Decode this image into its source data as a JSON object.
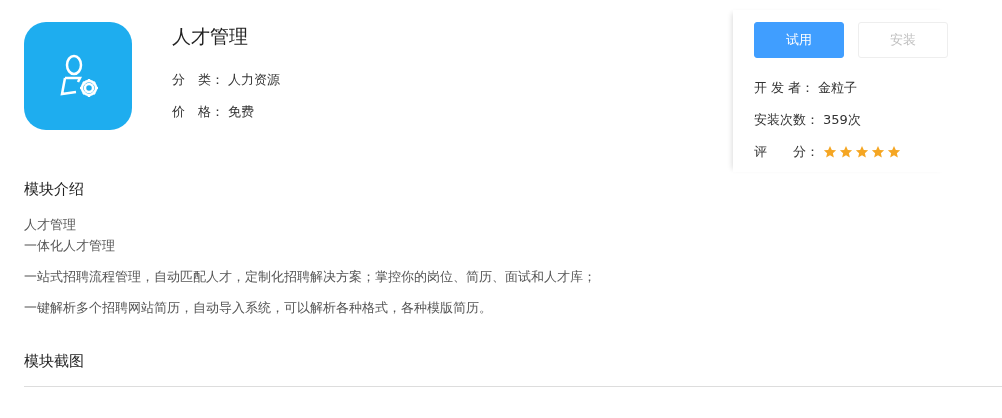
{
  "app": {
    "name": "人才管理",
    "fields": [
      {
        "label": "分　类：",
        "value": "人力资源"
      },
      {
        "label": "价　格：",
        "value": "免费"
      }
    ]
  },
  "actions": [
    {
      "label": "试用",
      "disabled": false
    },
    {
      "label": "安装",
      "disabled": true
    }
  ],
  "meta": {
    "developer": {
      "label": "开 发 者：",
      "value": "金粒子"
    },
    "installs": {
      "label": "安装次数：",
      "value": "359次"
    },
    "rating": {
      "label": "评　　分：",
      "stars": 5
    }
  },
  "intro": {
    "title": "模块介绍",
    "paragraphs": [
      [
        "人才管理",
        "一体化人才管理"
      ],
      [
        "一站式招聘流程管理，自动匹配人才，定制化招聘解决方案；掌控你的岗位、简历、面试和人才库；"
      ],
      [
        "一键解析多个招聘网站简历，自动导入系统，可以解析各种格式，各种模版简历。"
      ]
    ]
  },
  "screenshots": {
    "title": "模块截图"
  }
}
